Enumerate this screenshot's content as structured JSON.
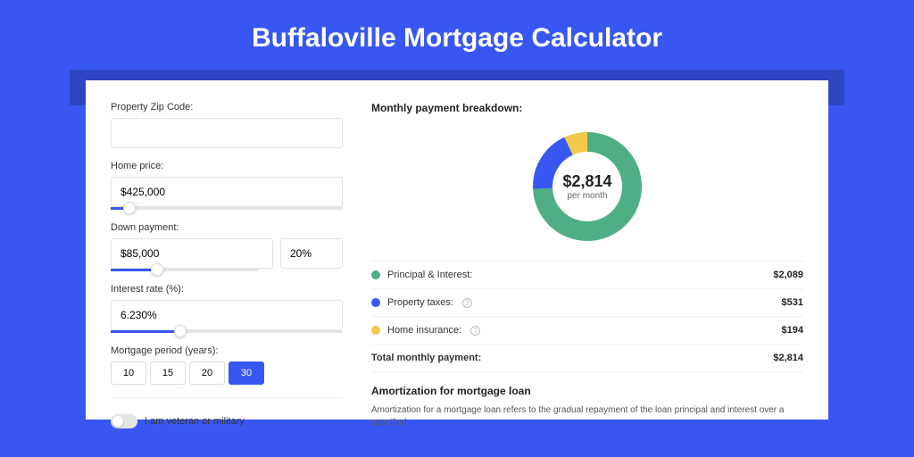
{
  "page": {
    "title": "Buffaloville Mortgage Calculator"
  },
  "form": {
    "zip": {
      "label": "Property Zip Code:",
      "value": ""
    },
    "home_price": {
      "label": "Home price:",
      "value": "$425,000",
      "slider_pct": 8
    },
    "down_payment": {
      "label": "Down payment:",
      "amount": "$85,000",
      "percent": "20%",
      "slider_pct": 20
    },
    "interest": {
      "label": "Interest rate (%):",
      "value": "6.230%",
      "slider_pct": 30
    },
    "period": {
      "label": "Mortgage period (years):",
      "options": [
        "10",
        "15",
        "20",
        "30"
      ],
      "active_index": 3
    },
    "veteran": {
      "label": "I am veteran or military",
      "checked": false
    }
  },
  "breakdown": {
    "title": "Monthly payment breakdown:",
    "center_amount": "$2,814",
    "center_sub": "per month",
    "items": [
      {
        "label": "Principal & Interest:",
        "value": "$2,089",
        "color": "#4fae84",
        "info": false
      },
      {
        "label": "Property taxes:",
        "value": "$531",
        "color": "#3857f2",
        "info": true
      },
      {
        "label": "Home insurance:",
        "value": "$194",
        "color": "#f2c94c",
        "info": true
      }
    ],
    "total": {
      "label": "Total monthly payment:",
      "value": "$2,814"
    }
  },
  "chart_data": {
    "type": "pie",
    "title": "Monthly payment breakdown",
    "series": [
      {
        "name": "Principal & Interest",
        "value": 2089,
        "color": "#4fae84"
      },
      {
        "name": "Property taxes",
        "value": 531,
        "color": "#3857f2"
      },
      {
        "name": "Home insurance",
        "value": 194,
        "color": "#f2c94c"
      }
    ],
    "total": 2814,
    "center_label": "$2,814 per month"
  },
  "amortization": {
    "title": "Amortization for mortgage loan",
    "text": "Amortization for a mortgage loan refers to the gradual repayment of the loan principal and interest over a specified"
  }
}
